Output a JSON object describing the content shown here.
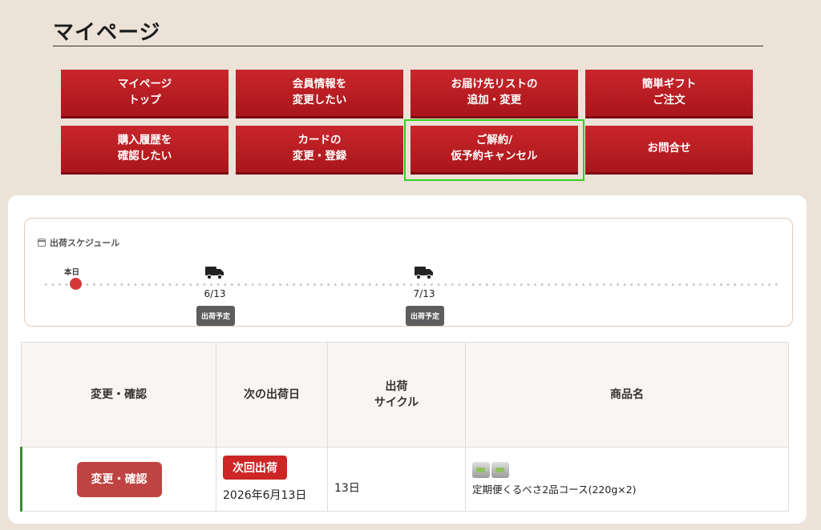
{
  "page": {
    "title": "マイページ"
  },
  "menu": {
    "buttons": [
      {
        "label": "マイページ\nトップ"
      },
      {
        "label": "会員情報を\n変更したい"
      },
      {
        "label": "お届け先リストの\n追加・変更"
      },
      {
        "label": "簡単ギフト\nご注文"
      },
      {
        "label": "購入履歴を\n確認したい"
      },
      {
        "label": "カードの\n変更・登録"
      },
      {
        "label": "ご解約/\n仮予約キャンセル"
      },
      {
        "label": "お問合せ"
      }
    ],
    "highlighted_index": 6
  },
  "schedule": {
    "heading": "出荷スケジュール",
    "icon": "calendar-icon",
    "today_label": "本日",
    "shipments": [
      {
        "date": "6/13",
        "badge": "出荷予定",
        "icon": "truck-icon"
      },
      {
        "date": "7/13",
        "badge": "出荷予定",
        "icon": "truck-icon"
      }
    ]
  },
  "orders": {
    "headers": [
      "変更・確認",
      "次の出荷日",
      "出荷\nサイクル",
      "商品名"
    ],
    "rows": [
      {
        "action_label": "変更・確認",
        "next_badge": "次回出荷",
        "next_date": "2026年6月13日",
        "cycle": "13日",
        "product_name": "定期便くるべさ2品コース(220g×2)"
      }
    ]
  },
  "colors": {
    "background": "#ece2d8",
    "brand_red": "#c8262b",
    "highlight": "#32d11c",
    "today_dot": "#d63838",
    "row_accent": "#3a8a3a"
  }
}
